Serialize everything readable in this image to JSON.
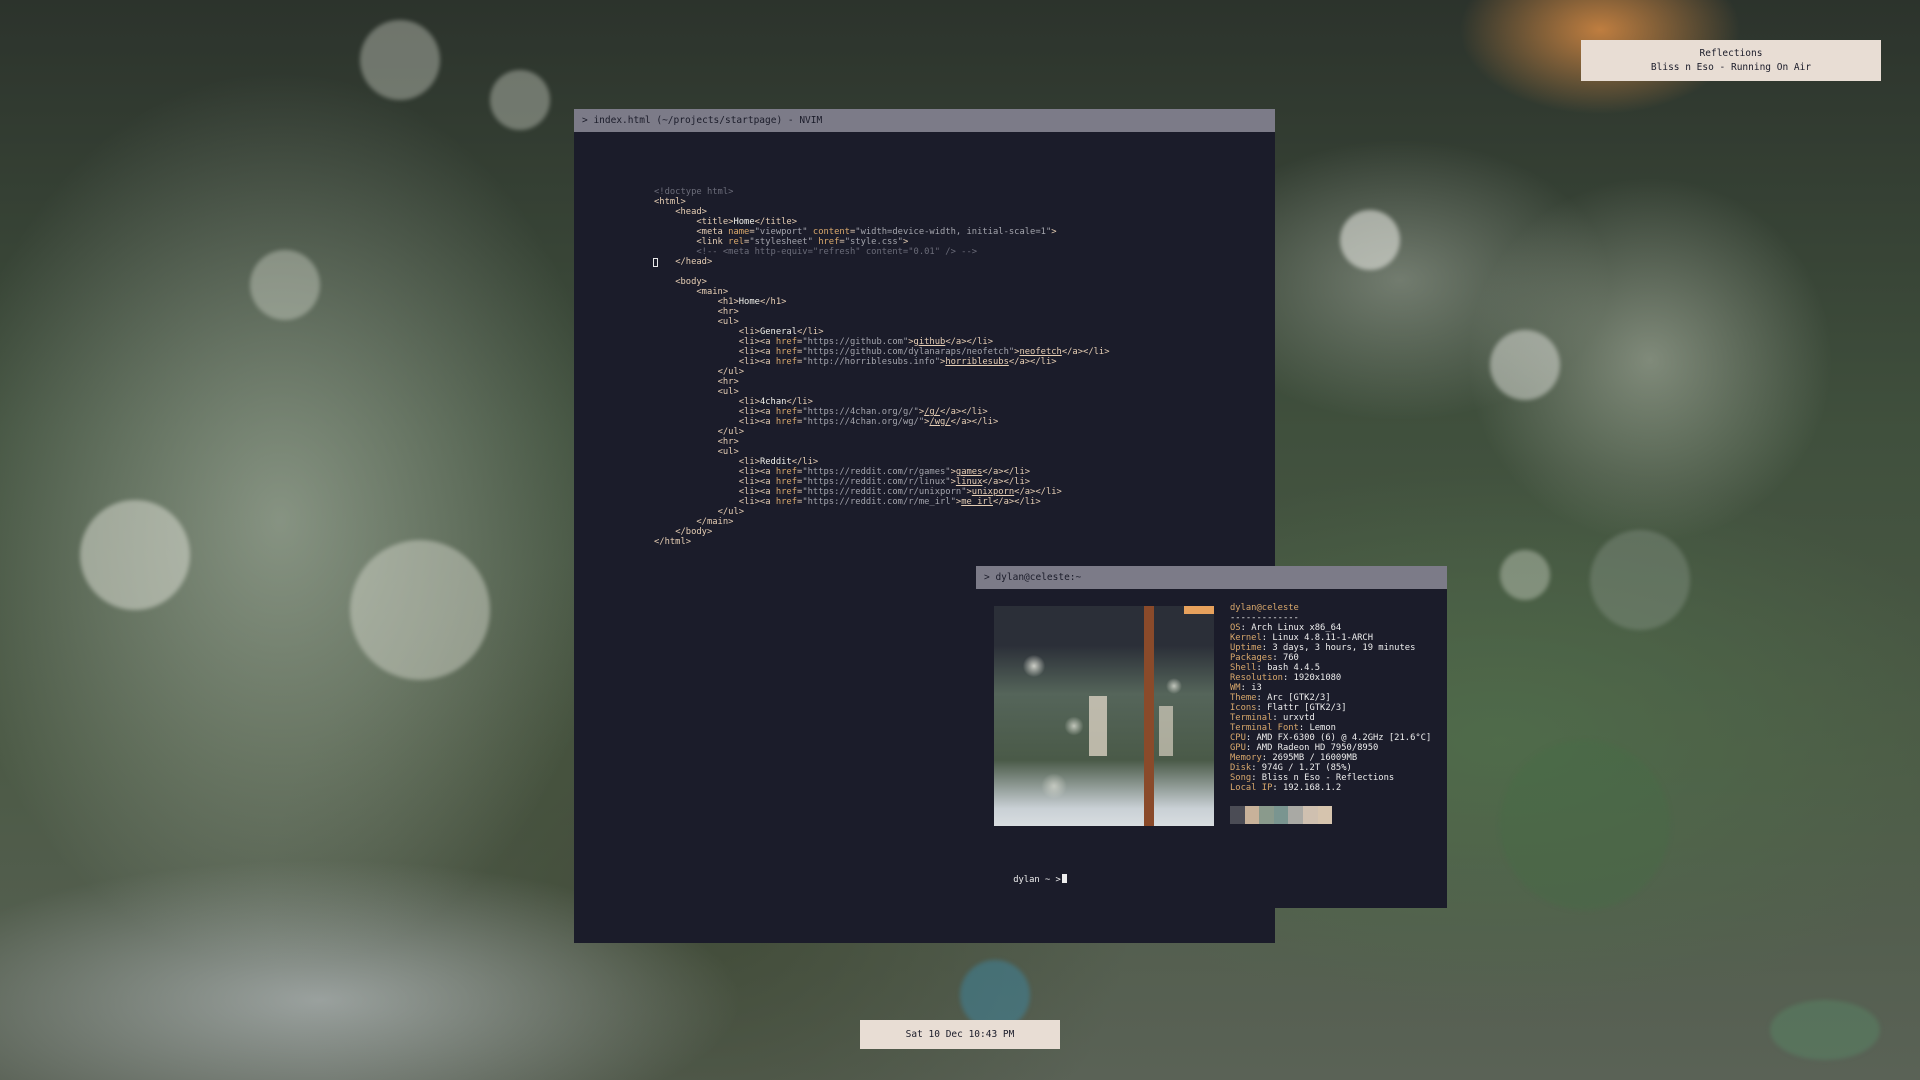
{
  "notification": {
    "title": "Reflections",
    "subtitle": "Bliss n Eso - Running On Air"
  },
  "clock": {
    "text": "Sat 10 Dec 10:43 PM"
  },
  "editor": {
    "title": "> index.html (~/projects/startpage) - NVIM",
    "lines": [
      [
        [
          "c-comment",
          "<!doctype html>"
        ]
      ],
      [
        [
          "c-tag",
          "<html>"
        ]
      ],
      [
        [
          "c-text",
          "    "
        ],
        [
          "c-tag",
          "<head>"
        ]
      ],
      [
        [
          "c-text",
          "        "
        ],
        [
          "c-tag",
          "<title>"
        ],
        [
          "c-text",
          "Home"
        ],
        [
          "c-tag",
          "</title>"
        ]
      ],
      [
        [
          "c-text",
          "        "
        ],
        [
          "c-tag",
          "<meta "
        ],
        [
          "c-attr",
          "name"
        ],
        [
          "c-tag",
          "="
        ],
        [
          "c-str",
          "\"viewport\""
        ],
        [
          "c-tag",
          " "
        ],
        [
          "c-attr",
          "content"
        ],
        [
          "c-tag",
          "="
        ],
        [
          "c-str",
          "\"width=device-width, initial-scale=1\""
        ],
        [
          "c-tag",
          ">"
        ]
      ],
      [
        [
          "c-text",
          "        "
        ],
        [
          "c-tag",
          "<link "
        ],
        [
          "c-attr",
          "rel"
        ],
        [
          "c-tag",
          "="
        ],
        [
          "c-str",
          "\"stylesheet\""
        ],
        [
          "c-tag",
          " "
        ],
        [
          "c-attr",
          "href"
        ],
        [
          "c-tag",
          "="
        ],
        [
          "c-str",
          "\"style.css\""
        ],
        [
          "c-tag",
          ">"
        ]
      ],
      [
        [
          "c-text",
          "        "
        ],
        [
          "c-comment",
          "<!-- <meta http-equiv=\"refresh\" content=\"0.01\" /> -->"
        ]
      ],
      [
        [
          "c-text",
          "    "
        ],
        [
          "c-tag",
          "</head>"
        ]
      ],
      [
        [
          "c-text",
          ""
        ]
      ],
      [
        [
          "c-text",
          "    "
        ],
        [
          "c-tag",
          "<body>"
        ]
      ],
      [
        [
          "c-text",
          "        "
        ],
        [
          "c-tag",
          "<main>"
        ]
      ],
      [
        [
          "c-text",
          "            "
        ],
        [
          "c-tag",
          "<h1>"
        ],
        [
          "c-text",
          "Home"
        ],
        [
          "c-tag",
          "</h1>"
        ]
      ],
      [
        [
          "c-text",
          "            "
        ],
        [
          "c-tag",
          "<hr>"
        ]
      ],
      [
        [
          "c-text",
          "            "
        ],
        [
          "c-tag",
          "<ul>"
        ]
      ],
      [
        [
          "c-text",
          "                "
        ],
        [
          "c-tag",
          "<li>"
        ],
        [
          "c-text",
          "General"
        ],
        [
          "c-tag",
          "</li>"
        ]
      ],
      [
        [
          "c-text",
          "                "
        ],
        [
          "c-tag",
          "<li><a "
        ],
        [
          "c-attr",
          "href"
        ],
        [
          "c-tag",
          "="
        ],
        [
          "c-str",
          "\"https://github.com\""
        ],
        [
          "c-tag",
          ">"
        ],
        [
          "c-link",
          "github"
        ],
        [
          "c-tag",
          "</a></li>"
        ]
      ],
      [
        [
          "c-text",
          "                "
        ],
        [
          "c-tag",
          "<li><a "
        ],
        [
          "c-attr",
          "href"
        ],
        [
          "c-tag",
          "="
        ],
        [
          "c-str",
          "\"https://github.com/dylanaraps/neofetch\""
        ],
        [
          "c-tag",
          ">"
        ],
        [
          "c-link",
          "neofetch"
        ],
        [
          "c-tag",
          "</a></li>"
        ]
      ],
      [
        [
          "c-text",
          "                "
        ],
        [
          "c-tag",
          "<li><a "
        ],
        [
          "c-attr",
          "href"
        ],
        [
          "c-tag",
          "="
        ],
        [
          "c-str",
          "\"http://horriblesubs.info\""
        ],
        [
          "c-tag",
          ">"
        ],
        [
          "c-link",
          "horriblesubs"
        ],
        [
          "c-tag",
          "</a></li>"
        ]
      ],
      [
        [
          "c-text",
          "            "
        ],
        [
          "c-tag",
          "</ul>"
        ]
      ],
      [
        [
          "c-text",
          "            "
        ],
        [
          "c-tag",
          "<hr>"
        ]
      ],
      [
        [
          "c-text",
          "            "
        ],
        [
          "c-tag",
          "<ul>"
        ]
      ],
      [
        [
          "c-text",
          "                "
        ],
        [
          "c-tag",
          "<li>"
        ],
        [
          "c-text",
          "4chan"
        ],
        [
          "c-tag",
          "</li>"
        ]
      ],
      [
        [
          "c-text",
          "                "
        ],
        [
          "c-tag",
          "<li><a "
        ],
        [
          "c-attr",
          "href"
        ],
        [
          "c-tag",
          "="
        ],
        [
          "c-str",
          "\"https://4chan.org/g/\""
        ],
        [
          "c-tag",
          ">"
        ],
        [
          "c-link",
          "/g/"
        ],
        [
          "c-tag",
          "</a></li>"
        ]
      ],
      [
        [
          "c-text",
          "                "
        ],
        [
          "c-tag",
          "<li><a "
        ],
        [
          "c-attr",
          "href"
        ],
        [
          "c-tag",
          "="
        ],
        [
          "c-str",
          "\"https://4chan.org/wg/\""
        ],
        [
          "c-tag",
          ">"
        ],
        [
          "c-link",
          "/wg/"
        ],
        [
          "c-tag",
          "</a></li>"
        ]
      ],
      [
        [
          "c-text",
          "            "
        ],
        [
          "c-tag",
          "</ul>"
        ]
      ],
      [
        [
          "c-text",
          "            "
        ],
        [
          "c-tag",
          "<hr>"
        ]
      ],
      [
        [
          "c-text",
          "            "
        ],
        [
          "c-tag",
          "<ul>"
        ]
      ],
      [
        [
          "c-text",
          "                "
        ],
        [
          "c-tag",
          "<li>"
        ],
        [
          "c-text",
          "Reddit"
        ],
        [
          "c-tag",
          "</li>"
        ]
      ],
      [
        [
          "c-text",
          "                "
        ],
        [
          "c-tag",
          "<li><a "
        ],
        [
          "c-attr",
          "href"
        ],
        [
          "c-tag",
          "="
        ],
        [
          "c-str",
          "\"https://reddit.com/r/games\""
        ],
        [
          "c-tag",
          ">"
        ],
        [
          "c-link",
          "games"
        ],
        [
          "c-tag",
          "</a></li>"
        ]
      ],
      [
        [
          "c-text",
          "                "
        ],
        [
          "c-tag",
          "<li><a "
        ],
        [
          "c-attr",
          "href"
        ],
        [
          "c-tag",
          "="
        ],
        [
          "c-str",
          "\"https://reddit.com/r/linux\""
        ],
        [
          "c-tag",
          ">"
        ],
        [
          "c-link",
          "linux"
        ],
        [
          "c-tag",
          "</a></li>"
        ]
      ],
      [
        [
          "c-text",
          "                "
        ],
        [
          "c-tag",
          "<li><a "
        ],
        [
          "c-attr",
          "href"
        ],
        [
          "c-tag",
          "="
        ],
        [
          "c-str",
          "\"https://reddit.com/r/unixporn\""
        ],
        [
          "c-tag",
          ">"
        ],
        [
          "c-link",
          "unixporn"
        ],
        [
          "c-tag",
          "</a></li>"
        ]
      ],
      [
        [
          "c-text",
          "                "
        ],
        [
          "c-tag",
          "<li><a "
        ],
        [
          "c-attr",
          "href"
        ],
        [
          "c-tag",
          "="
        ],
        [
          "c-str",
          "\"https://reddit.com/r/me_irl\""
        ],
        [
          "c-tag",
          ">"
        ],
        [
          "c-link",
          "me_irl"
        ],
        [
          "c-tag",
          "</a></li>"
        ]
      ],
      [
        [
          "c-text",
          "            "
        ],
        [
          "c-tag",
          "</ul>"
        ]
      ],
      [
        [
          "c-text",
          "        "
        ],
        [
          "c-tag",
          "</main>"
        ]
      ],
      [
        [
          "c-text",
          "    "
        ],
        [
          "c-tag",
          "</body>"
        ]
      ],
      [
        [
          "c-tag",
          "</html>"
        ]
      ]
    ]
  },
  "terminal": {
    "title": "> dylan@celeste:~",
    "user_host": "dylan@celeste",
    "separator": "-------------",
    "info": [
      [
        "OS",
        "Arch Linux x86_64"
      ],
      [
        "Kernel",
        "Linux 4.8.11-1-ARCH"
      ],
      [
        "Uptime",
        "3 days, 3 hours, 19 minutes"
      ],
      [
        "Packages",
        "760"
      ],
      [
        "Shell",
        "bash 4.4.5"
      ],
      [
        "Resolution",
        "1920x1080"
      ],
      [
        "WM",
        "i3"
      ],
      [
        "Theme",
        "Arc [GTK2/3]"
      ],
      [
        "Icons",
        "Flattr [GTK2/3]"
      ],
      [
        "Terminal",
        "urxvtd"
      ],
      [
        "Terminal Font",
        "Lemon"
      ],
      [
        "CPU",
        "AMD FX-6300 (6) @ 4.2GHz [21.6°C]"
      ],
      [
        "GPU",
        "AMD Radeon HD 7950/8950"
      ],
      [
        "Memory",
        "2695MB / 16009MB"
      ],
      [
        "Disk",
        "974G / 1.2T (85%)"
      ],
      [
        "Song",
        "Bliss n Eso - Reflections"
      ],
      [
        "Local IP",
        "192.168.1.2"
      ]
    ],
    "palette": [
      "#4b4c55",
      "#c8b29a",
      "#8a9a8c",
      "#7a9590",
      "#a9a9a4",
      "#cfc0b0",
      "#d6c4ae"
    ],
    "prompt": "dylan ~ >"
  }
}
